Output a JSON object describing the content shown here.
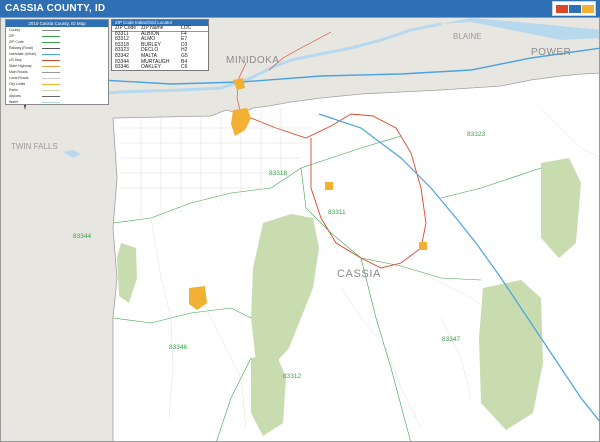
{
  "title": "CASSIA COUNTY, ID",
  "legend": {
    "title": "2010 Cassia County, ID Map",
    "rows": [
      {
        "label": "County",
        "color": "#888888"
      },
      {
        "label": "ZIP",
        "color": "#3aa34a"
      },
      {
        "label": "ZIP Code",
        "color": "#3aa34a"
      },
      {
        "label": "Railway (Rural)",
        "color": "#555555"
      },
      {
        "label": "Interstate (Urban)",
        "color": "#4aa3df"
      },
      {
        "label": "US Hwy",
        "color": "#d9482b"
      },
      {
        "label": "State Highway",
        "color": "#e0a040"
      },
      {
        "label": "Main Roads",
        "color": "#999999"
      },
      {
        "label": "Local Roads",
        "color": "#cccccc"
      },
      {
        "label": "City Limits",
        "color": "#f2b134"
      },
      {
        "label": "Parks",
        "color": "#c8dcb0"
      },
      {
        "label": "Airports",
        "color": "#666666"
      },
      {
        "label": "Water",
        "color": "#b8d8ee"
      }
    ]
  },
  "zip_table": {
    "title": "ZIP Code Index/Grid Locator",
    "headers": [
      "ZIP Code",
      "ZIP Name",
      "LOC"
    ],
    "rows": [
      [
        "83311",
        "ALBION",
        "F4"
      ],
      [
        "83312",
        "ALMO",
        "E7"
      ],
      [
        "83318",
        "BURLEY",
        "D3"
      ],
      [
        "83323",
        "DECLO",
        "H2"
      ],
      [
        "83342",
        "MALTA",
        "G5"
      ],
      [
        "83344",
        "MURTAUGH",
        "B4"
      ],
      [
        "83346",
        "OAKLEY",
        "C6"
      ]
    ]
  },
  "labels": {
    "minidoka": "MINIDOKA",
    "blaine": "BLAINE",
    "power": "POWER",
    "twin_falls": "TWIN FALLS",
    "cassia": "CASSIA"
  },
  "zip_labels": {
    "z83323": "83323",
    "z83318": "83318",
    "z83311": "83311",
    "z83344": "83344",
    "z83346": "83346",
    "z83347": "83347",
    "z83312": "83312"
  },
  "colors": {
    "title_bar": "#2f6fb3",
    "outside_county": "#e8e6e1",
    "park": "#c8dcb0",
    "water": "#b8d8ee",
    "interstate": "#4aa3df",
    "us_highway": "#d9482b",
    "city": "#f2b134",
    "zip_boundary": "#3aa34a"
  },
  "icons": [
    "compass-rose-icon",
    "brand-logo"
  ]
}
